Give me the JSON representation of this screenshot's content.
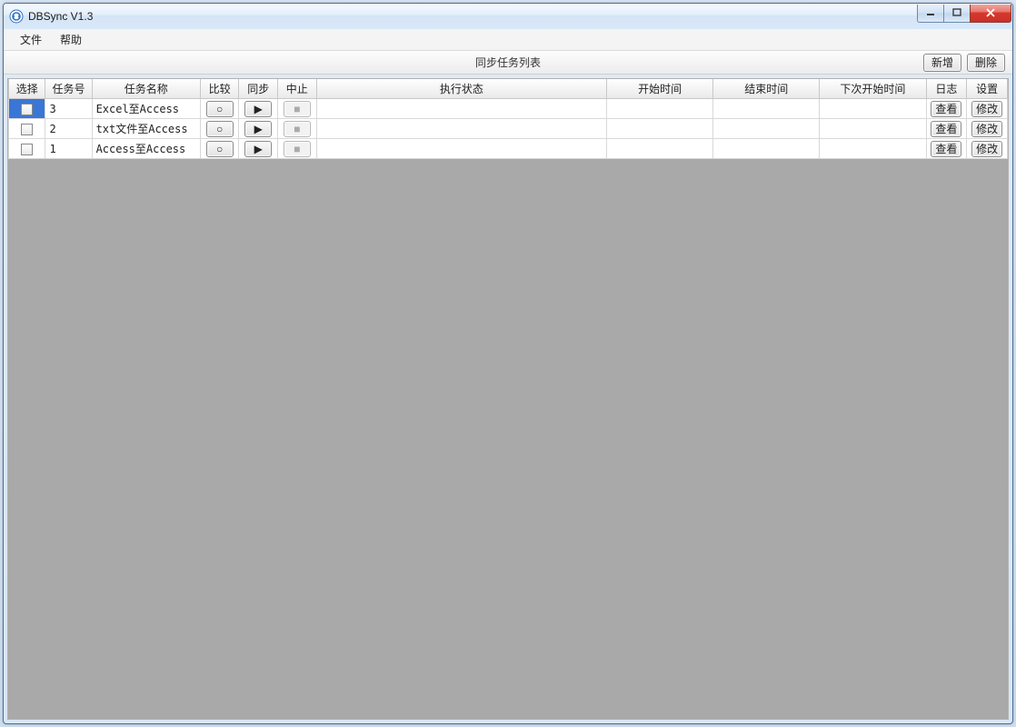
{
  "window": {
    "title": "DBSync V1.3"
  },
  "menu": {
    "file": "文件",
    "help": "帮助"
  },
  "toolbar": {
    "title": "同步任务列表",
    "add": "新增",
    "delete": "删除"
  },
  "columns": {
    "select": "选择",
    "task_num": "任务号",
    "task_name": "任务名称",
    "compare": "比较",
    "sync": "同步",
    "stop": "中止",
    "status": "执行状态",
    "start_time": "开始时间",
    "end_time": "结束时间",
    "next_start": "下次开始时间",
    "log": "日志",
    "settings": "设置"
  },
  "buttons": {
    "view": "查看",
    "modify": "修改"
  },
  "icons": {
    "compare": "○",
    "sync": "▶",
    "stop": "■"
  },
  "tasks": [
    {
      "selected": true,
      "num": "3",
      "name": "Excel至Access",
      "status": "",
      "start": "",
      "end": "",
      "next": "",
      "stop_enabled": false
    },
    {
      "selected": false,
      "num": "2",
      "name": "txt文件至Access",
      "status": "",
      "start": "",
      "end": "",
      "next": "",
      "stop_enabled": false
    },
    {
      "selected": false,
      "num": "1",
      "name": "Access至Access",
      "status": "",
      "start": "",
      "end": "",
      "next": "",
      "stop_enabled": false
    }
  ]
}
